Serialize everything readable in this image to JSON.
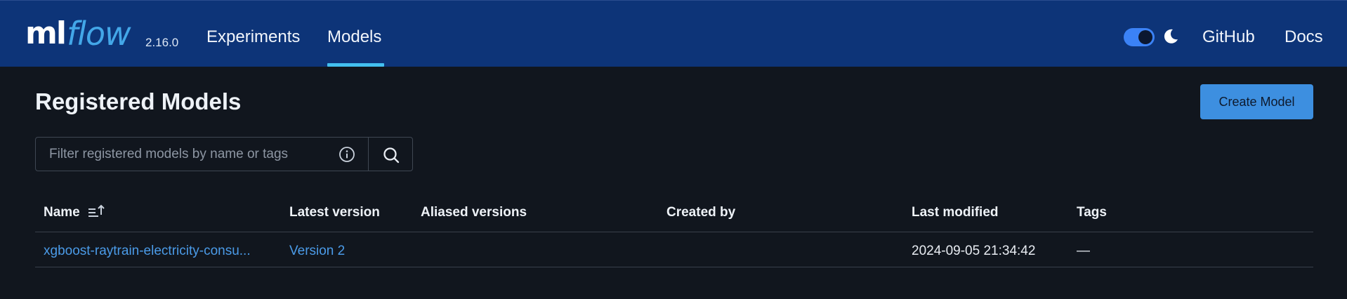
{
  "header": {
    "logo_ml": "ml",
    "logo_flow": "flow",
    "version": "2.16.0",
    "nav": {
      "experiments": "Experiments",
      "models": "Models",
      "github": "GitHub",
      "docs": "Docs"
    },
    "theme_toggle": {
      "state": "on",
      "icon": "moon-icon"
    },
    "colors": {
      "background": "#0d3478",
      "accent": "#43c0f0"
    }
  },
  "page": {
    "title": "Registered Models",
    "create_button": "Create Model"
  },
  "search": {
    "placeholder": "Filter registered models by name or tags",
    "value": ""
  },
  "table": {
    "columns": {
      "name": "Name",
      "latest_version": "Latest version",
      "aliased_versions": "Aliased versions",
      "created_by": "Created by",
      "last_modified": "Last modified",
      "tags": "Tags"
    },
    "rows": [
      {
        "name": "xgboost-raytrain-electricity-consu...",
        "latest_version": "Version 2",
        "aliased_versions": "",
        "created_by": "",
        "last_modified": "2024-09-05 21:34:42",
        "tags": "—"
      }
    ]
  }
}
